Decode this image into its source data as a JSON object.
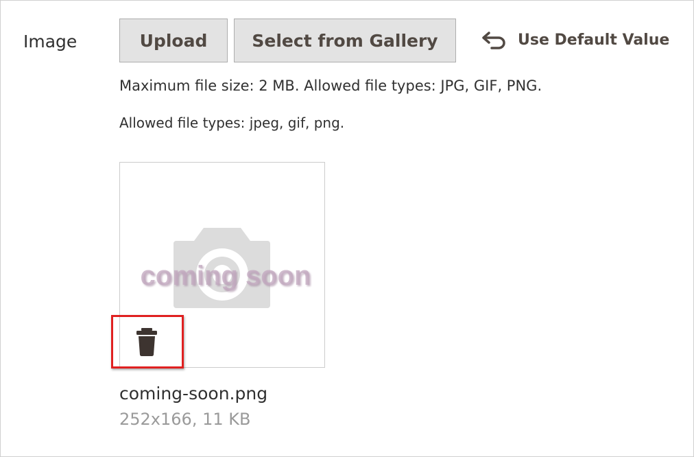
{
  "field": {
    "label": "Image"
  },
  "actions": {
    "upload_label": "Upload",
    "gallery_label": "Select from Gallery",
    "use_default_label": "Use Default Value"
  },
  "notes": {
    "max_size": "Maximum file size: 2 MB. Allowed file types: JPG, GIF, PNG.",
    "allowed_types": "Allowed file types: jpeg, gif, png."
  },
  "preview": {
    "placeholder_text": "coming soon",
    "file_name": "coming-soon.png",
    "file_meta": "252x166, 11 KB"
  },
  "icons": {
    "use_default": "undo-arrow-icon",
    "delete": "trash-icon",
    "placeholder": "camera-icon"
  },
  "colors": {
    "highlight": "#e02020",
    "button_bg": "#e3e3e3",
    "button_text": "#514943",
    "placeholder_text": "#c3a9c0"
  }
}
